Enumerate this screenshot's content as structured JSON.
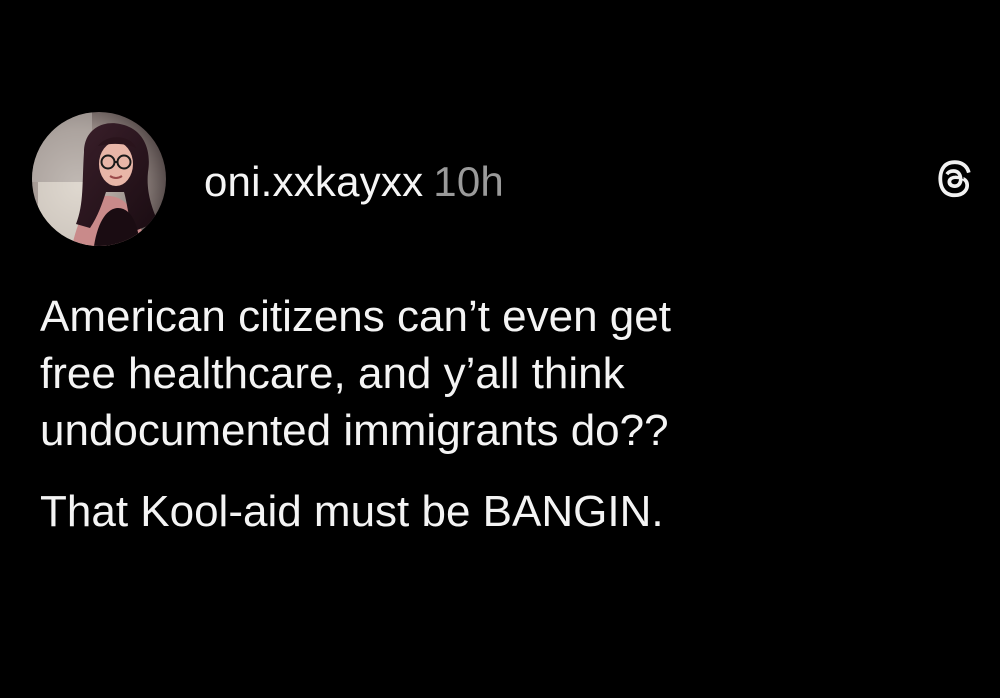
{
  "post": {
    "author": {
      "username": "oni.xxkayxx",
      "timestamp": "10h",
      "avatar_icon": "profile-photo"
    },
    "app_icon": "threads-logo-icon",
    "paragraphs": [
      "American citizens can’t even get\nfree healthcare, and y’all think\nundocumented immigrants do??",
      "That Kool-aid must be BANGIN."
    ]
  },
  "colors": {
    "background": "#000000",
    "text": "#f4f4f4",
    "timestamp": "#9a9a9a"
  }
}
